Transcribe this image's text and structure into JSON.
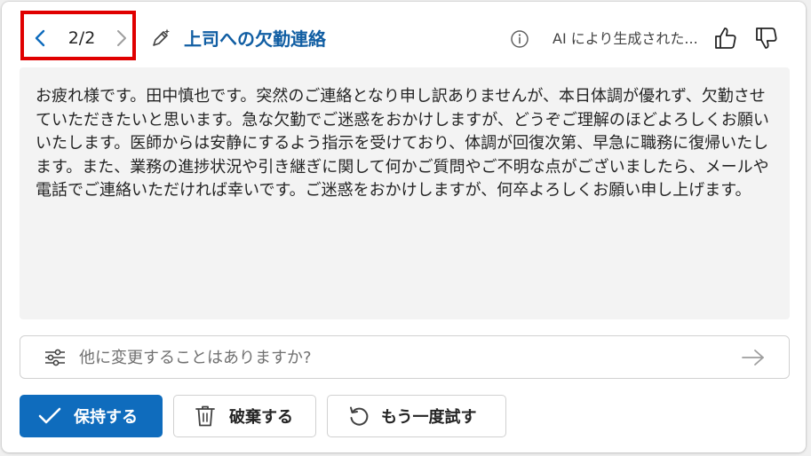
{
  "navigation": {
    "counter": "2/2"
  },
  "header": {
    "title": "上司への欠勤連絡",
    "ai_label": "AI により生成された..."
  },
  "draft": {
    "body": "お疲れ様です。田中慎也です。突然のご連絡となり申し訳ありませんが、本日体調が優れず、欠勤させていただきたいと思います。急な欠勤でご迷惑をおかけしますが、どうぞご理解のほどよろしくお願いいたします。医師からは安静にするよう指示を受けており、体調が回復次第、早急に職務に復帰いたします。また、業務の進捗状況や引き継ぎに関して何かご質問やご不明な点がございましたら、メールや電話でご連絡いただければ幸いです。ご迷惑をおかけしますが、何卒よろしくお願い申し上げます。"
  },
  "prompt": {
    "placeholder": "他に変更することはありますか?",
    "value": ""
  },
  "actions": {
    "keep_label": "保持する",
    "discard_label": "破棄する",
    "retry_label": "もう一度試す"
  },
  "icons": {
    "prev": "chevron-left-icon",
    "next": "chevron-right-icon",
    "title": "pen-sparkle-icon",
    "info": "info-icon",
    "like": "thumbs-up-icon",
    "dislike": "thumbs-down-icon",
    "settings": "sliders-icon",
    "send": "arrow-right-icon",
    "keep": "checkmark-icon",
    "discard": "trash-icon",
    "retry": "retry-icon"
  },
  "colors": {
    "accent": "#0f6cbd",
    "title": "#115ea3",
    "highlight": "#e00000",
    "body_background": "#f3f3f3"
  }
}
